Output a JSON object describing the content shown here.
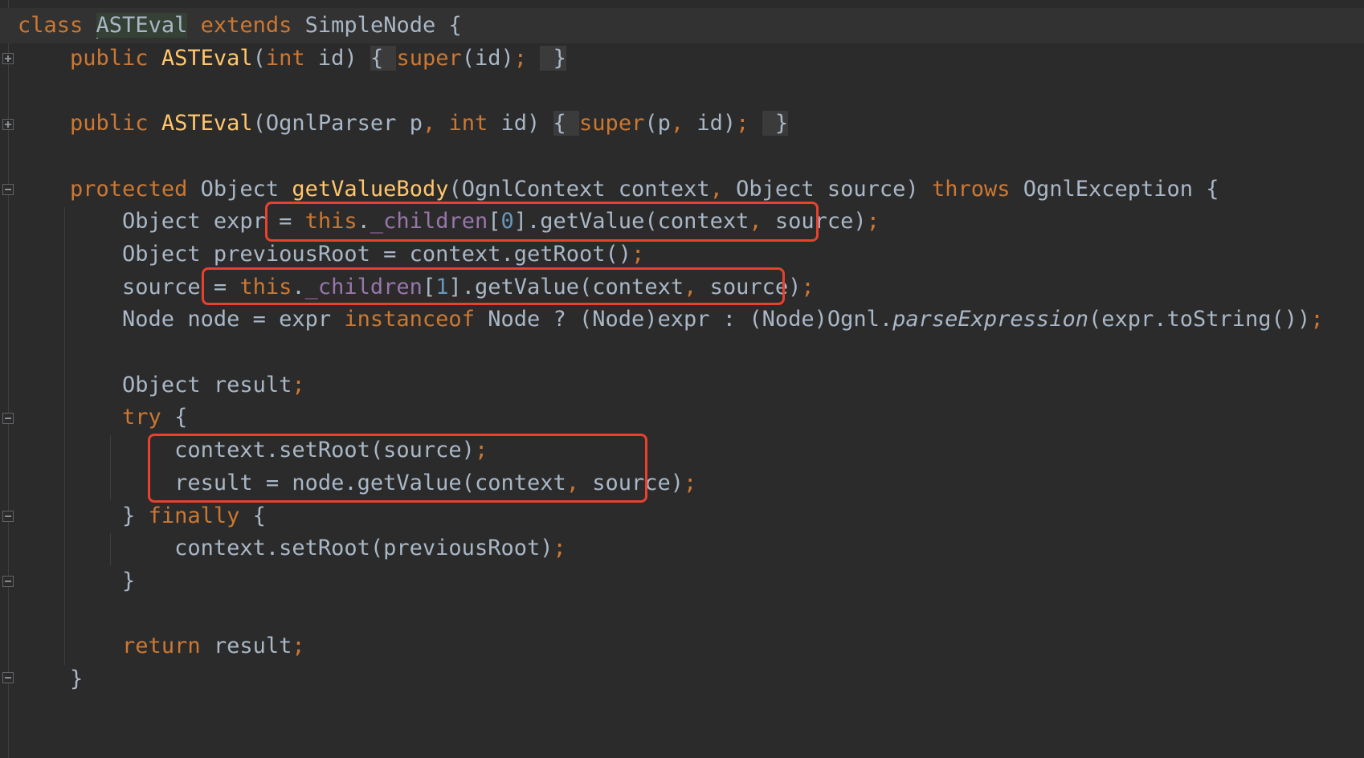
{
  "editor": {
    "lines": [
      {
        "id": "class-decl",
        "tokens": [
          {
            "t": "class ",
            "c": "kw"
          },
          {
            "t": "",
            "c": "caret"
          },
          {
            "t": "ASTEval",
            "c": "cls-hl"
          },
          {
            "t": " "
          },
          {
            "t": "extends",
            "c": "kw"
          },
          {
            "t": " SimpleNode {"
          }
        ]
      },
      {
        "id": "ctor-1",
        "tokens": [
          {
            "t": "    "
          },
          {
            "t": "public ",
            "c": "kw"
          },
          {
            "t": "ASTEval",
            "c": "fn"
          },
          {
            "t": "("
          },
          {
            "t": "int",
            "c": "kw"
          },
          {
            "t": " id) "
          },
          {
            "t": "{ ",
            "c": "fold-bg"
          },
          {
            "t": "super",
            "c": "kw"
          },
          {
            "t": "(id)"
          },
          {
            "t": ";",
            "c": "semi"
          },
          {
            "t": " "
          },
          {
            "t": " }",
            "c": "fold-bg"
          }
        ]
      },
      {
        "id": "blank-1",
        "tokens": []
      },
      {
        "id": "ctor-2",
        "tokens": [
          {
            "t": "    "
          },
          {
            "t": "public ",
            "c": "kw"
          },
          {
            "t": "ASTEval",
            "c": "fn"
          },
          {
            "t": "(OgnlParser p"
          },
          {
            "t": ", ",
            "c": "kw"
          },
          {
            "t": "int",
            "c": "kw"
          },
          {
            "t": " id) "
          },
          {
            "t": "{ ",
            "c": "fold-bg"
          },
          {
            "t": "super",
            "c": "kw"
          },
          {
            "t": "(p"
          },
          {
            "t": ", ",
            "c": "kw"
          },
          {
            "t": "id)"
          },
          {
            "t": ";",
            "c": "semi"
          },
          {
            "t": " "
          },
          {
            "t": " }",
            "c": "fold-bg"
          }
        ]
      },
      {
        "id": "blank-2",
        "tokens": []
      },
      {
        "id": "method-sig",
        "tokens": [
          {
            "t": "    "
          },
          {
            "t": "protected ",
            "c": "kw"
          },
          {
            "t": "Object "
          },
          {
            "t": "getValueBody",
            "c": "fn"
          },
          {
            "t": "(OgnlContext context"
          },
          {
            "t": ", ",
            "c": "kw"
          },
          {
            "t": "Object source) "
          },
          {
            "t": "throws ",
            "c": "kw"
          },
          {
            "t": "OgnlException {"
          }
        ]
      },
      {
        "id": "expr-line",
        "tokens": [
          {
            "t": "        Object expr = "
          },
          {
            "t": "this",
            "c": "kw"
          },
          {
            "t": "."
          },
          {
            "t": "_children",
            "c": "fld"
          },
          {
            "t": "["
          },
          {
            "t": "0",
            "c": "num"
          },
          {
            "t": "].getValue(context"
          },
          {
            "t": ", ",
            "c": "kw"
          },
          {
            "t": "source)"
          },
          {
            "t": ";",
            "c": "semi"
          }
        ]
      },
      {
        "id": "prevroot-line",
        "tokens": [
          {
            "t": "        Object previousRoot = context.getRoot()"
          },
          {
            "t": ";",
            "c": "semi"
          }
        ]
      },
      {
        "id": "source-line",
        "tokens": [
          {
            "t": "        source = "
          },
          {
            "t": "this",
            "c": "kw"
          },
          {
            "t": "."
          },
          {
            "t": "_children",
            "c": "fld"
          },
          {
            "t": "["
          },
          {
            "t": "1",
            "c": "num"
          },
          {
            "t": "].getValue(context"
          },
          {
            "t": ", ",
            "c": "kw"
          },
          {
            "t": "source)"
          },
          {
            "t": ";",
            "c": "semi"
          }
        ]
      },
      {
        "id": "node-line",
        "tokens": [
          {
            "t": "        Node node = expr "
          },
          {
            "t": "instanceof",
            "c": "kw"
          },
          {
            "t": " Node ? (Node)expr : (Node)Ognl."
          },
          {
            "t": "parseExpression",
            "c": "it"
          },
          {
            "t": "(expr.toString())"
          },
          {
            "t": ";",
            "c": "semi"
          }
        ]
      },
      {
        "id": "blank-3",
        "tokens": []
      },
      {
        "id": "result-decl",
        "tokens": [
          {
            "t": "        Object result"
          },
          {
            "t": ";",
            "c": "semi"
          }
        ]
      },
      {
        "id": "try-line",
        "tokens": [
          {
            "t": "        "
          },
          {
            "t": "try",
            "c": "kw"
          },
          {
            "t": " {"
          }
        ]
      },
      {
        "id": "setroot-source",
        "tokens": [
          {
            "t": "            context.setRoot(source)"
          },
          {
            "t": ";",
            "c": "semi"
          }
        ]
      },
      {
        "id": "result-assign",
        "tokens": [
          {
            "t": "            result = node.getValue(context"
          },
          {
            "t": ", ",
            "c": "kw"
          },
          {
            "t": "source)"
          },
          {
            "t": ";",
            "c": "semi"
          }
        ]
      },
      {
        "id": "finally-line",
        "tokens": [
          {
            "t": "        } "
          },
          {
            "t": "finally",
            "c": "kw"
          },
          {
            "t": " {"
          }
        ]
      },
      {
        "id": "setroot-prev",
        "tokens": [
          {
            "t": "            context.setRoot(previousRoot)"
          },
          {
            "t": ";",
            "c": "semi"
          }
        ]
      },
      {
        "id": "close-finally",
        "tokens": [
          {
            "t": "        }"
          }
        ]
      },
      {
        "id": "blank-4",
        "tokens": []
      },
      {
        "id": "return-line",
        "tokens": [
          {
            "t": "        "
          },
          {
            "t": "return",
            "c": "kw"
          },
          {
            "t": " result"
          },
          {
            "t": ";",
            "c": "semi"
          }
        ]
      },
      {
        "id": "close-method",
        "tokens": [
          {
            "t": "    }"
          }
        ]
      }
    ]
  },
  "colors": {
    "background": "#2b2b2b",
    "keyword": "#cc7832",
    "function": "#ffc66d",
    "number": "#6897bb",
    "field": "#9876aa",
    "text": "#a9b7c6",
    "highlight_box": "#e8412d"
  },
  "icons": {
    "fold_expand": "plus-fold-icon",
    "fold_collapse": "minus-fold-icon"
  }
}
